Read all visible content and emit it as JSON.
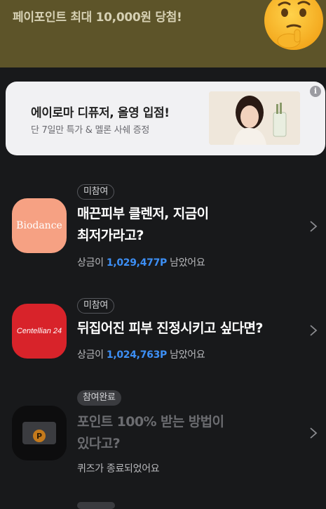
{
  "top_banner": {
    "text": "페이포인트 최대 10,000원 당첨!",
    "bg_color": "#5d5429"
  },
  "ad": {
    "title": "에이로마 디퓨저, 올영 입점!",
    "subtitle": "단 7일만 특가 & 멜론 사쉐 증정",
    "info_icon": "info-icon",
    "image_icon": "product-photo"
  },
  "quizzes": [
    {
      "badge": "미참여",
      "title_line1": "매끈피부 클렌저, 지금이",
      "title_line2": "최저가라고?",
      "prize_prefix": "상금이 ",
      "prize_amount": "1,029,477P",
      "prize_suffix": " 남았어요",
      "logo_text": "Biodance",
      "logo_color": "#f6a183"
    },
    {
      "badge": "미참여",
      "title_line1": "뒤집어진 피부 진정시키고 싶다면?",
      "prize_prefix": "상금이 ",
      "prize_amount": "1,024,763P",
      "prize_suffix": " 남았어요",
      "logo_text": "Centellian 24",
      "logo_color": "#d8232a"
    },
    {
      "badge": "참여완료",
      "title_line1": "포인트 100% 받는 방법이",
      "title_line2": "있다고?",
      "status": "퀴즈가 종료되었어요",
      "logo_icon": "point-card-icon",
      "logo_color": "#0d0d0e"
    }
  ],
  "colors": {
    "accent_blue": "#3d8ff5",
    "background": "#18191b"
  }
}
